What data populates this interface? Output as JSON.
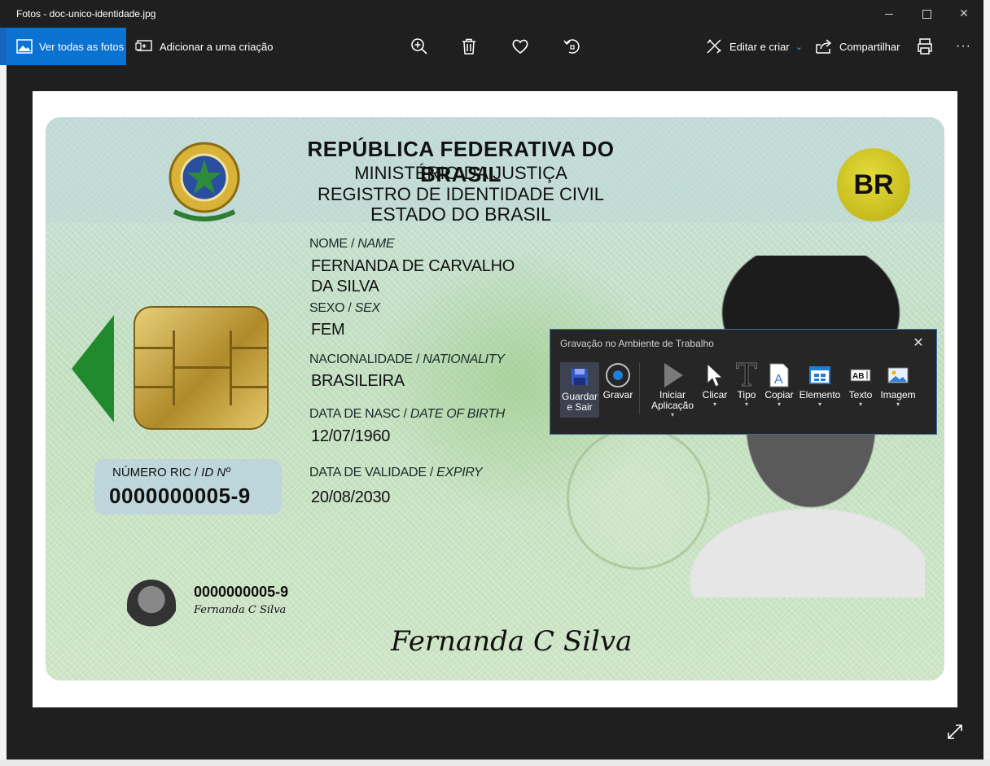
{
  "window": {
    "title": "Fotos - doc-unico-identidade.jpg",
    "controls": {
      "minimize": "minimize-icon",
      "maximize": "maximize-icon",
      "close": "close-icon"
    }
  },
  "toolbar": {
    "see_all": "Ver todas as fotos",
    "add_creation": "Adicionar a uma criação",
    "edit_create": "Editar e criar",
    "share": "Compartilhar",
    "more": "···",
    "icons": [
      "zoom-in-icon",
      "delete-icon",
      "favorite-icon",
      "rotate-icon",
      "print-icon"
    ]
  },
  "id_card": {
    "header": {
      "line1": "REPÚBLICA FEDERATIVA DO BRASIL",
      "line2": "MINISTÉRIO DA JUSTIÇA",
      "line3": "REGISTRO DE IDENTIDADE CIVIL",
      "line4": "ESTADO DO BRASIL"
    },
    "badge": "BR",
    "name_label": "NOME / ",
    "name_label_en": "NAME",
    "name_line1": "FERNANDA DE CARVALHO",
    "name_line2": "DA SILVA",
    "sex_label": "SEXO / ",
    "sex_label_en": "SEX",
    "sex_value": "FEM",
    "nationality_label": "NACIONALIDADE / ",
    "nationality_label_en": "NATIONALITY",
    "nationality_value": "BRASILEIRA",
    "birth_label": "DATA DE NASC / ",
    "birth_label_en": "DATE OF BIRTH",
    "birth_value": "12/07/1960",
    "expiry_label": "DATA DE VALIDADE / ",
    "expiry_label_en": "EXPIRY",
    "expiry_value": "20/08/2030",
    "ric_label": "NÚMERO RIC / ",
    "ric_label_en": "ID Nº",
    "ric_value": "0000000005-9",
    "mini_id": "0000000005-9",
    "mini_signature": "Fernanda C Silva",
    "signature": "Fernanda C Silva"
  },
  "recorder": {
    "title": "Gravação no Ambiente de Trabalho",
    "items": {
      "save_exit": "Guardar e Sair",
      "record": "Gravar",
      "start_app": "Iniciar Aplicação",
      "click": "Clicar",
      "type": "Tipo",
      "copy": "Copiar",
      "element": "Elemento",
      "text": "Texto",
      "image": "Imagem"
    },
    "colors": {
      "border": "#3d6ea6",
      "record_dot": "#1e7fd6",
      "active_bg": "#3c4250"
    }
  },
  "colors": {
    "accent": "#0a73d2",
    "window_bg": "#1f1f1f"
  }
}
